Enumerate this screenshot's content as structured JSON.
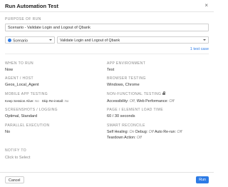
{
  "dialog": {
    "title": "Run Automation Test",
    "close_glyph": "×"
  },
  "purpose": {
    "label": "PURPOSE OF RUN",
    "value": "Scenario - Validate Login and Logout of Qbank"
  },
  "selectors": {
    "type_value": "Scenario",
    "scenario_value": "Validate Login and Logout of Qbank",
    "test_case_link": "1 test case"
  },
  "left": {
    "when_label": "WHEN TO RUN",
    "when_value": "Now",
    "agent_label": "AGENT / HOST",
    "agent_value": "Geos_Local_Agent",
    "mobile_label": "MOBILE APP TESTING",
    "keep_session": "Keep Session Alive:",
    "keep_session_val": "No",
    "skip_reinstall": "Skip Re-install:",
    "skip_reinstall_val": "No",
    "screens_label": "SCREENSHOTS / LOGGING",
    "screens_value": "Optimal, Standard",
    "parallel_label": "PARALLEL EXECUTION",
    "parallel_value": "No",
    "notify_label": "NOTIFY TO",
    "notify_value": "Click to Select"
  },
  "right": {
    "env_label": "APP ENVIRONMENT",
    "env_value": "Test",
    "browser_label": "BROWSER TESTING",
    "browser_value": "Windows, Chrome",
    "nft_label": "NON-FUNCTIONAL TESTING",
    "accessibility": "Accessibility:",
    "accessibility_val": "Off,",
    "web_perf": "Web Performance:",
    "web_perf_val": "Off",
    "load_label": "PAGE / ELEMENT LOAD TIME",
    "load_value": "60 / 30 seconds",
    "smart_label": "SMART RECONCILE",
    "self_healing": "Self Healing:",
    "self_healing_val": "On",
    "debug": "Debug:",
    "debug_val": "Off",
    "auto_rerun": "Auto Re-run:",
    "auto_rerun_val": "Off",
    "teardown": "Teardown Action:",
    "teardown_val": "Off"
  },
  "footer": {
    "cancel": "Cancel",
    "run": "Run"
  },
  "colors": {
    "accent": "#2d7be5"
  }
}
